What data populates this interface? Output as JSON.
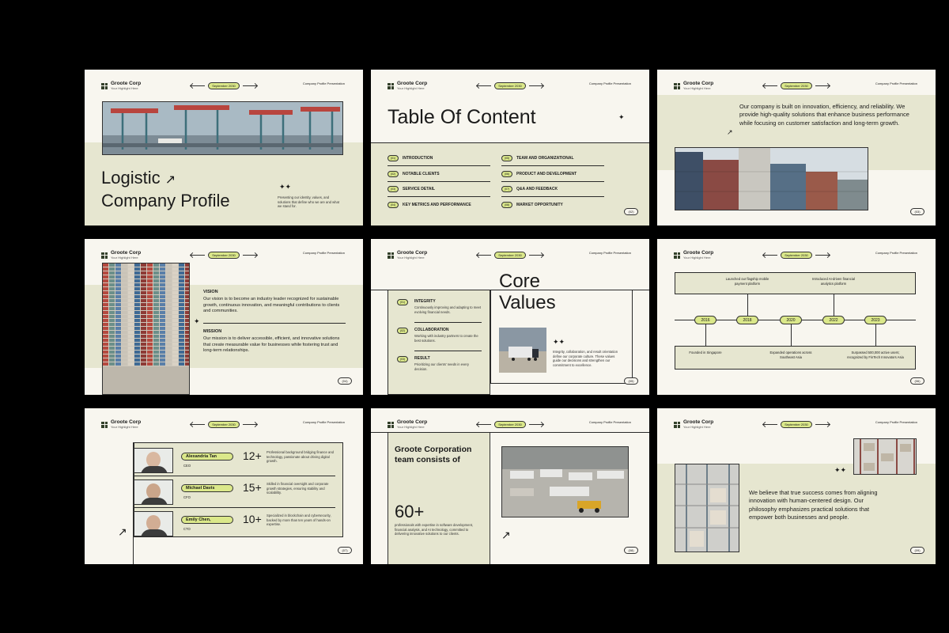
{
  "brand": {
    "name": "Groote Corp",
    "tagline": "Your Highlight Here"
  },
  "date_label": "September 2030",
  "header_right": "Company Profile Presentation",
  "colors": {
    "accent": "#dbe88a",
    "panel": "#e6e6d0",
    "paper": "#f8f6ef",
    "background": "#000000"
  },
  "slide1": {
    "title_line1": "Logistic",
    "title_line2": "Company Profile",
    "blurb": "Presenting our identity, values, and solutions that define who we are and what we stand for."
  },
  "slide2": {
    "title": "Table Of Content",
    "page": "(02)",
    "items": [
      {
        "num": "(01)",
        "label": "INTRODUCTION"
      },
      {
        "num": "(02)",
        "label": "NOTABLE CLIENTS"
      },
      {
        "num": "(03)",
        "label": "SERVICE DETAIL"
      },
      {
        "num": "(04)",
        "label": "KEY METRICS AND PERFORMANCE"
      },
      {
        "num": "(05)",
        "label": "TEAM AND ORGANIZATIONAL"
      },
      {
        "num": "(06)",
        "label": "PRODUCT AND DEVELOPMENT"
      },
      {
        "num": "(07)",
        "label": "Q&A AND FEEDBACK"
      },
      {
        "num": "(08)",
        "label": "MARKET OPPORTUNITY"
      }
    ]
  },
  "slide3": {
    "statement": "Our company is built on innovation, efficiency, and reliability. We provide high-quality solutions that enhance business performance while focusing on customer satisfaction and long-term growth.",
    "page": "(03)"
  },
  "slide4": {
    "vision_title": "VISION",
    "vision_text": "Our vision is to become an industry leader recognized for sustainable growth, continuous innovation, and meaningful contributions to clients and communities.",
    "mission_title": "MISSION",
    "mission_text": "Our mission is to deliver accessible, efficient, and innovative solutions that create measurable value for businesses while fostering trust and long-term relationships.",
    "page": "(04)"
  },
  "slide5": {
    "title_line1": "Core",
    "title_line2": "Values",
    "values": [
      {
        "num": "(01)",
        "title": "INTEGRITY",
        "text": "Continuously improving and adapting to meet evolving financial needs."
      },
      {
        "num": "(02)",
        "title": "COLLABORATION",
        "text": "Working with industry partners to create the best solutions."
      },
      {
        "num": "(03)",
        "title": "RESULT",
        "text": "Prioritizing our clients' needs in every decision."
      }
    ],
    "summary": "Integrity, collaboration, and result orientation define our corporate culture. These values guide our decisions and strengthen our commitment to excellence.",
    "page": "(05)"
  },
  "slide6": {
    "years": [
      "2016",
      "2018",
      "2020",
      "2022",
      "2023"
    ],
    "top_events": [
      "Launched our flagship mobile payment platform",
      "Introduced AI-driven financial analytics platform"
    ],
    "bottom_events": [
      "Founded in Singapore",
      "Expanded operations across Southeast Asia",
      "Surpassed 500,000 active users; recognized by FinTech Innovators Asia"
    ],
    "page": "(06)"
  },
  "slide7": {
    "people": [
      {
        "name": "Alexandria Tan",
        "role": "CEO",
        "years": "12+",
        "bio": "Professional background bridging finance and technology, passionate about driving digital growth."
      },
      {
        "name": "Michael Davis",
        "role": "CFO",
        "years": "15+",
        "bio": "Skilled in financial oversight and corporate growth strategies, ensuring stability and scalability."
      },
      {
        "name": "Emily Chen,",
        "role": "CTO",
        "years": "10+",
        "bio": "Specialized in blockchain and cybersecurity, backed by more than ten years of hands-on expertise."
      }
    ],
    "page": "(07)"
  },
  "slide8": {
    "heading": "Groote Corporation team consists of",
    "stat": "60+",
    "text": "professionals with expertise in software development, financial analysis, and AI technology, committed to delivering innovative solutions to our clients.",
    "page": "(08)"
  },
  "slide9": {
    "statement": "We believe that true success comes from aligning innovation with human-centered design. Our philosophy emphasizes practical solutions that empower both businesses and people.",
    "page": "(09)"
  }
}
